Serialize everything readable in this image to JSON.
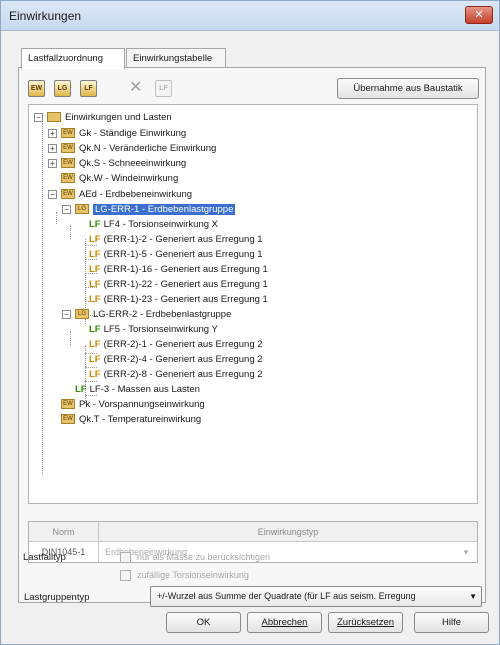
{
  "window": {
    "title": "Einwirkungen",
    "close_label": "✕"
  },
  "tabs": [
    {
      "label": "Lastfallzuordnung",
      "active": true
    },
    {
      "label": "Einwirkungstabelle",
      "active": false
    }
  ],
  "toolbar": {
    "icons": [
      {
        "name": "new-action-icon",
        "text": "EW"
      },
      {
        "name": "new-load-group-icon",
        "text": "LG"
      },
      {
        "name": "new-load-case-icon",
        "text": "LF"
      },
      {
        "name": "delete-icon",
        "text": "✕"
      },
      {
        "name": "disabled-action-icon",
        "text": "LF"
      }
    ],
    "import_button": "Übernahme aus Baustatik"
  },
  "tree": {
    "root": "Einwirkungen und Lasten",
    "items": [
      {
        "tag": "",
        "label": "Gk - Ständige Einwirkung"
      },
      {
        "tag": "",
        "label": "Qk.N - Veränderliche Einwirkung"
      },
      {
        "tag": "",
        "label": "Qk.S - Schneeeinwirkung"
      },
      {
        "tag": "",
        "label": "Qk.W - Windeinwirkung"
      },
      {
        "tag": "",
        "label": "AEd - Erdbebeneinwirkung"
      },
      {
        "tag": "",
        "label": "LG-ERR-1 - Erdbebenlastgruppe"
      },
      {
        "tag": "LF",
        "label": "LF4 - Torsionseinwirkung X"
      },
      {
        "tag": "LF",
        "label": "(ERR-1)-2 - Generiert aus Erregung 1"
      },
      {
        "tag": "LF",
        "label": "(ERR-1)-5 - Generiert aus Erregung 1"
      },
      {
        "tag": "LF",
        "label": "(ERR-1)-16 - Generiert aus Erregung 1"
      },
      {
        "tag": "LF",
        "label": "(ERR-1)-22 - Generiert aus Erregung 1"
      },
      {
        "tag": "LF",
        "label": "(ERR-1)-23 - Generiert aus Erregung 1"
      },
      {
        "tag": "",
        "label": "LG-ERR-2 - Erdbebenlastgruppe"
      },
      {
        "tag": "LF",
        "label": "LF5 - Torsionseinwirkung Y"
      },
      {
        "tag": "LF",
        "label": "(ERR-2)-1 - Generiert aus Erregung 2"
      },
      {
        "tag": "LF",
        "label": "(ERR-2)-4 - Generiert aus Erregung 2"
      },
      {
        "tag": "LF",
        "label": "(ERR-2)-8 - Generiert aus Erregung 2"
      },
      {
        "tag": "LF",
        "label": "LF-3 - Massen aus Lasten"
      },
      {
        "tag": "",
        "label": "Pk - Vorspannungseinwirkung"
      },
      {
        "tag": "",
        "label": "Qk.T - Temperatureinwirkung"
      }
    ]
  },
  "grid": {
    "headers": [
      "Norm",
      "Einwirkungstyp"
    ],
    "row": [
      "DIN1045-1",
      "Erdbebeneinwirkung"
    ]
  },
  "form": {
    "load_group_type_label": "Lastgruppentyp",
    "load_group_type_value": "+/-Wurzel aus Summe der Quadrate (für LF aus seism. Erregung",
    "load_case_type_label": "Lastfalltyp",
    "checkbox_mass_only": "nur als Masse zu berücksichtigen",
    "checkbox_random_torsion": "zufällige Torsionseinwirkung"
  },
  "buttons": {
    "ok": "OK",
    "cancel": "Abbrechen",
    "reset": "Zurücksetzen",
    "help": "Hilfe"
  }
}
